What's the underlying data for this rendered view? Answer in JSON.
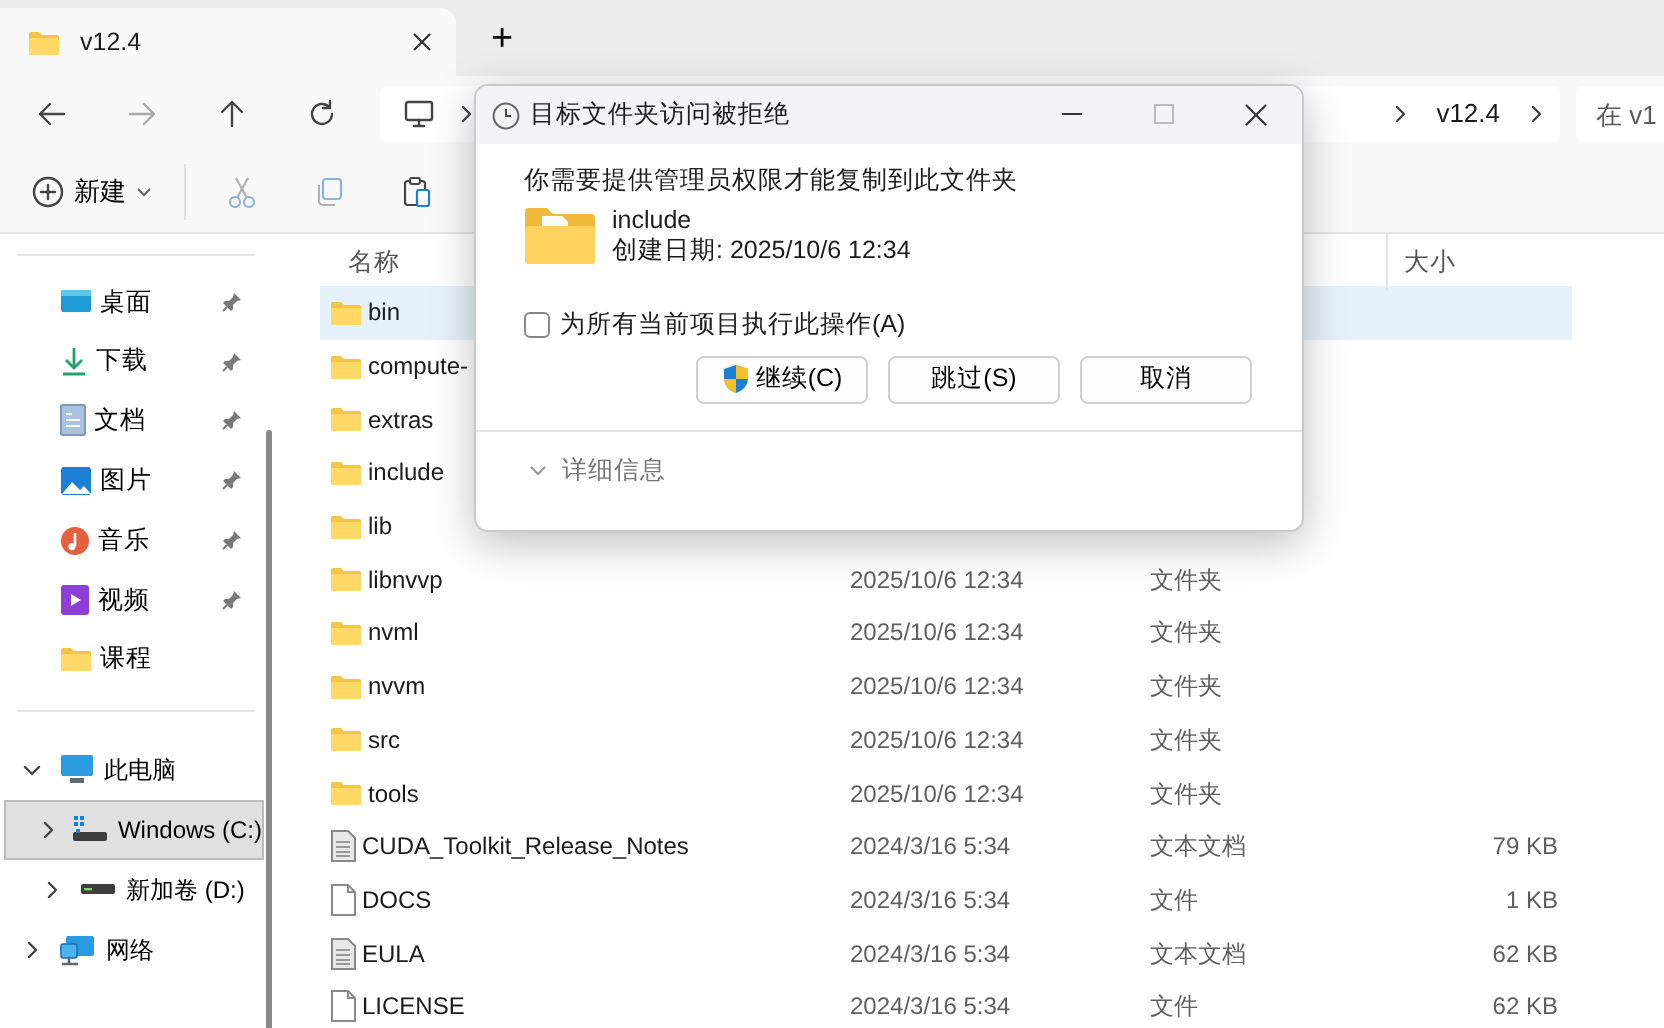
{
  "tabs": [
    {
      "label": "v12.4",
      "selected": true
    }
  ],
  "new_tab": "+",
  "address_bar": {
    "crumbs": [
      "v12.4"
    ]
  },
  "search": {
    "placeholder": "在 v1"
  },
  "toolbar": {
    "new_label": "新建"
  },
  "sidebar": {
    "quick_access": [
      {
        "label": "桌面",
        "pinned": true,
        "selected": false
      },
      {
        "label": "下载",
        "pinned": true,
        "selected": false
      },
      {
        "label": "文档",
        "pinned": true,
        "selected": false
      },
      {
        "label": "图片",
        "pinned": true,
        "selected": false
      },
      {
        "label": "音乐",
        "pinned": true,
        "selected": false
      },
      {
        "label": "视频",
        "pinned": true,
        "selected": false
      },
      {
        "label": "课程",
        "pinned": false,
        "selected": false
      }
    ],
    "tree": [
      {
        "label": "此电脑",
        "expanded": true,
        "selected": false,
        "children": [
          {
            "label": "Windows (C:)",
            "expanded": false,
            "selected": true
          },
          {
            "label": "新加卷 (D:)",
            "expanded": false,
            "selected": false
          }
        ]
      },
      {
        "label": "网络",
        "expanded": false,
        "selected": false
      }
    ]
  },
  "file_list": {
    "columns": [
      {
        "label": "名称",
        "kind": "name"
      },
      {
        "label": "大小",
        "kind": "size"
      }
    ],
    "rows": [
      {
        "name": "bin",
        "kind": "folder",
        "selected": true
      },
      {
        "name": "compute-",
        "kind": "folder",
        "selected": false
      },
      {
        "name": "extras",
        "kind": "folder",
        "selected": false
      },
      {
        "name": "include",
        "kind": "folder",
        "selected": false
      },
      {
        "name": "lib",
        "kind": "folder",
        "selected": false
      },
      {
        "name": "libnvvp",
        "kind": "folder",
        "date": "2025/10/6 12:34",
        "type": "文件夹",
        "selected": false
      },
      {
        "name": "nvml",
        "kind": "folder",
        "date": "2025/10/6 12:34",
        "type": "文件夹",
        "selected": false
      },
      {
        "name": "nvvm",
        "kind": "folder",
        "date": "2025/10/6 12:34",
        "type": "文件夹",
        "selected": false
      },
      {
        "name": "src",
        "kind": "folder",
        "date": "2025/10/6 12:34",
        "type": "文件夹",
        "selected": false
      },
      {
        "name": "tools",
        "kind": "folder",
        "date": "2025/10/6 12:34",
        "type": "文件夹",
        "selected": false
      },
      {
        "name": "CUDA_Toolkit_Release_Notes",
        "kind": "text",
        "date": "2024/3/16 5:34",
        "type": "文本文档",
        "size": "79 KB",
        "selected": false
      },
      {
        "name": "DOCS",
        "kind": "file",
        "date": "2024/3/16 5:34",
        "type": "文件",
        "size": "1 KB",
        "selected": false
      },
      {
        "name": "EULA",
        "kind": "text",
        "date": "2024/3/16 5:34",
        "type": "文本文档",
        "size": "62 KB",
        "selected": false
      },
      {
        "name": "LICENSE",
        "kind": "file",
        "date": "2024/3/16 5:34",
        "type": "文件",
        "size": "62 KB",
        "selected": false
      }
    ]
  },
  "dialog": {
    "title": "目标文件夹访问被拒绝",
    "message": "你需要提供管理员权限才能复制到此文件夹",
    "item_name": "include",
    "item_detail": "创建日期: 2025/10/6 12:34",
    "apply_all": {
      "label": "为所有当前项目执行此操作(A)",
      "checked": false
    },
    "buttons": [
      {
        "label": "继续(C)",
        "kind": "elevated"
      },
      {
        "label": "跳过(S)",
        "kind": "plain"
      },
      {
        "label": "取消",
        "kind": "plain"
      }
    ],
    "details": {
      "label": "详细信息",
      "expanded": false
    }
  }
}
